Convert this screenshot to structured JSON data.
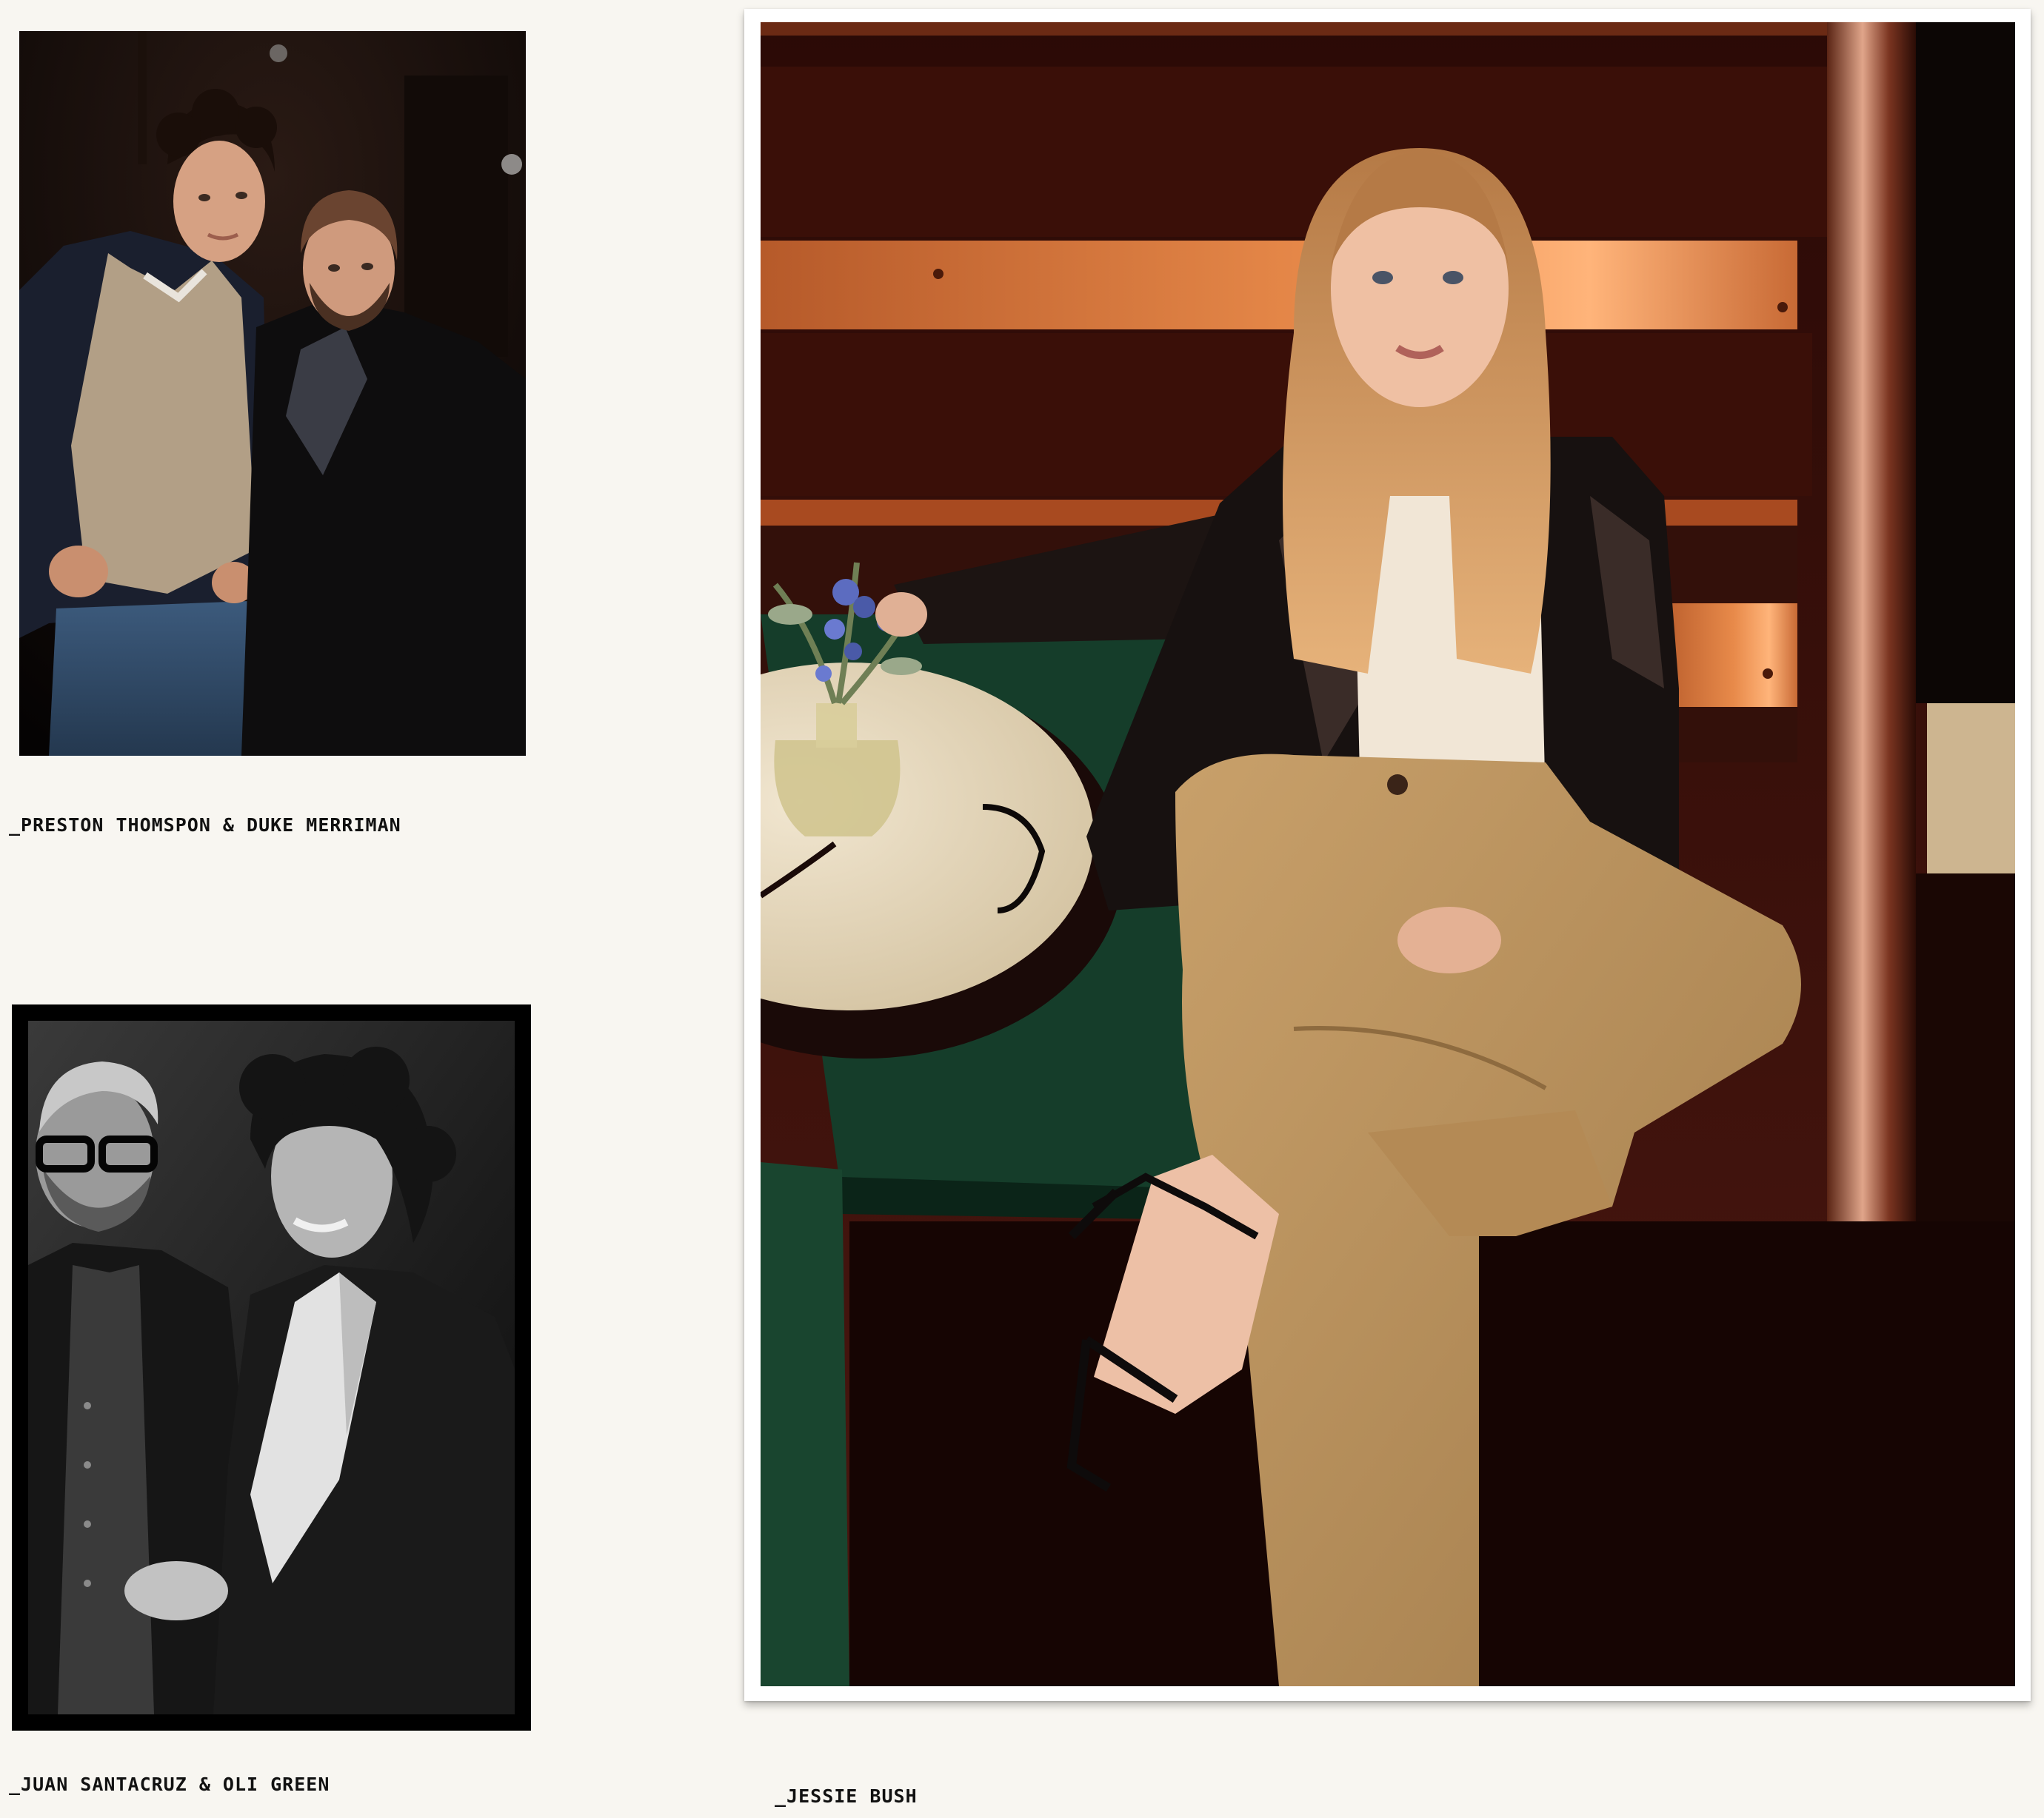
{
  "gallery": {
    "photos": [
      {
        "caption": "_PRESTON THOMSPON & DUKE MERRIMAN",
        "style": "color",
        "subject": "two-men-portrait"
      },
      {
        "caption": "_JUAN SANTACRUZ & OLI GREEN",
        "style": "black-and-white",
        "subject": "two-men-laughing"
      },
      {
        "caption": "_JESSIE BUSH",
        "style": "color",
        "subject": "woman-seated-in-booth"
      }
    ]
  },
  "colors": {
    "page_background": "#f8f6f1",
    "caption_text": "#111111",
    "frame_white": "#ffffff",
    "frame_black": "#000000"
  }
}
